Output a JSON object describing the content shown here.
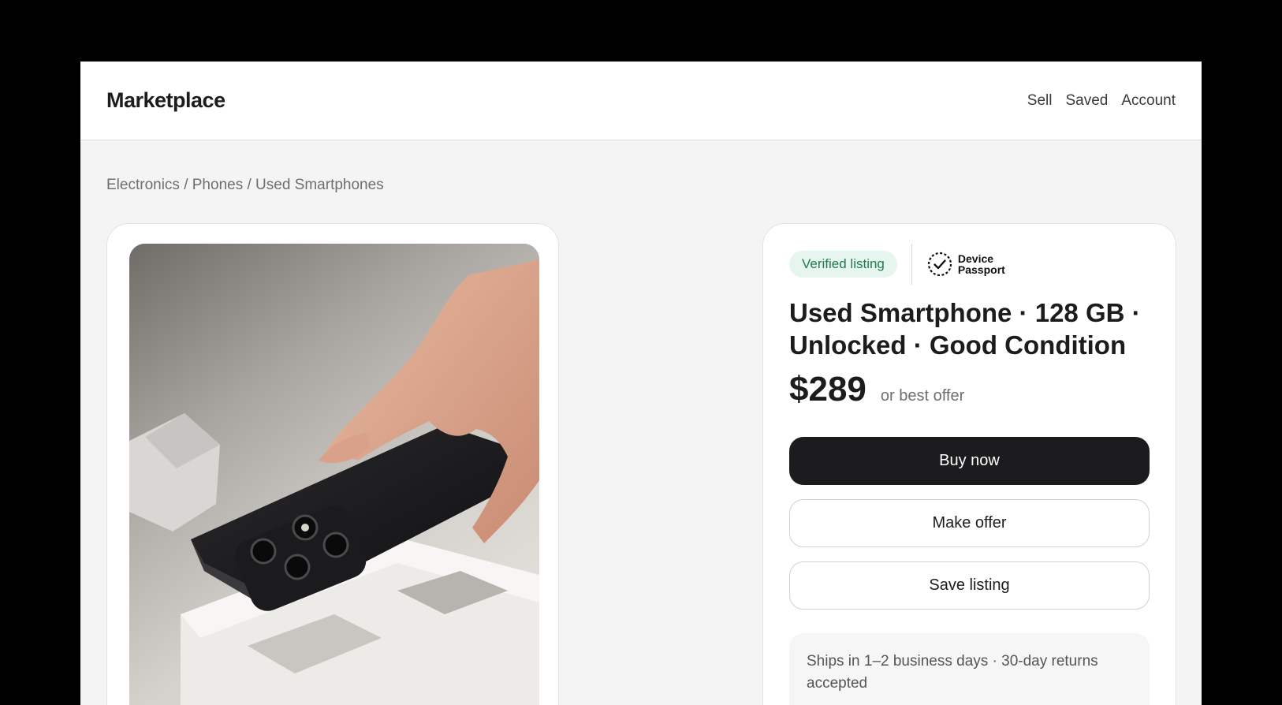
{
  "header": {
    "brand": "Marketplace",
    "nav": [
      "Sell",
      "Saved",
      "Account"
    ]
  },
  "breadcrumb": "Electronics / Phones / Used Smartphones",
  "listing": {
    "verified_badge": "Verified listing",
    "passport": {
      "line1": "Device",
      "line2": "Passport"
    },
    "title": "Used Smartphone · 128 GB · Unlocked · Good Condition",
    "price": "$289",
    "price_note": "or best offer",
    "buttons": {
      "buy": "Buy now",
      "offer": "Make offer",
      "save": "Save listing"
    },
    "shipping": "Ships in 1–2 business days · 30-day returns accepted"
  },
  "colors": {
    "primary_button": "#1c1c1e",
    "verified_bg": "#e6f6ee",
    "verified_text": "#1f7a4d"
  }
}
